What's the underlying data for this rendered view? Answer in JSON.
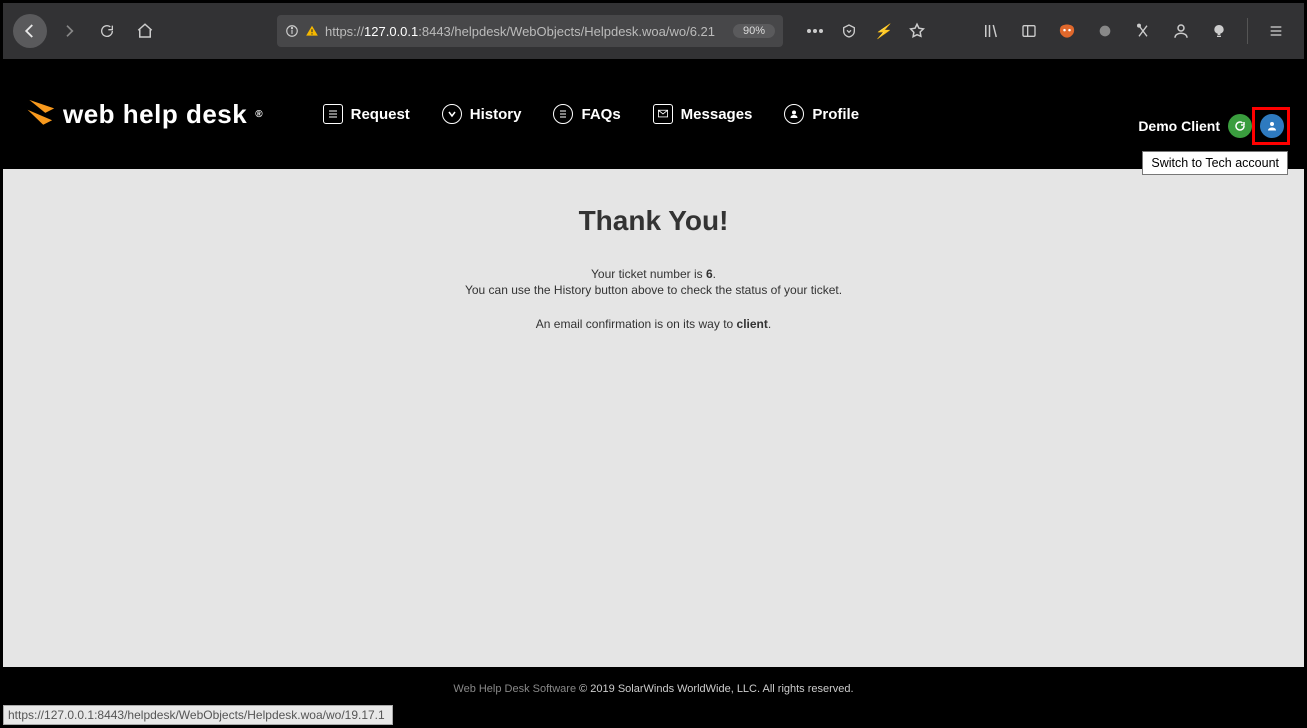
{
  "browser": {
    "url_prefix": "https://",
    "url_host": "127.0.0.1",
    "url_port_path": ":8443/helpdesk/WebObjects/Helpdesk.woa/wo/6.21",
    "zoom": "90%"
  },
  "header": {
    "logo_text": "web help desk",
    "nav": [
      {
        "key": "request",
        "label": "Request"
      },
      {
        "key": "history",
        "label": "History"
      },
      {
        "key": "faqs",
        "label": "FAQs"
      },
      {
        "key": "messages",
        "label": "Messages"
      },
      {
        "key": "profile",
        "label": "Profile"
      }
    ],
    "user_label": "Demo Client",
    "tooltip": "Switch to Tech account"
  },
  "main": {
    "title": "Thank You!",
    "line1_a": "Your ticket number is ",
    "line1_b": "6",
    "line1_c": ".",
    "line2": "You can use the History button above to check the status of your ticket.",
    "line3_a": "An email confirmation is on its way to ",
    "line3_b": "client",
    "line3_c": "."
  },
  "footer": {
    "product": "Web Help Desk Software",
    "copyright": " © 2019 SolarWinds WorldWide, LLC. All rights reserved.",
    "status_url": "https://127.0.0.1:8443/helpdesk/WebObjects/Helpdesk.woa/wo/19.17.1"
  }
}
